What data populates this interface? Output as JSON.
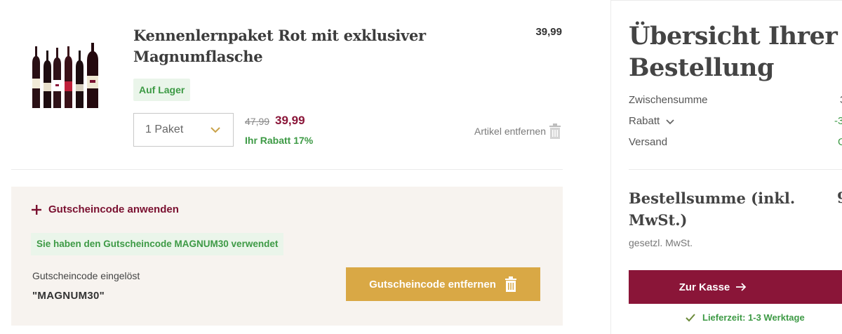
{
  "cart_item": {
    "title": "Kennenlernpaket Rot mit exklusiver Magnumflasche",
    "price": "39,99",
    "stock_status": "Auf Lager",
    "quantity_selected": "1 Paket",
    "old_price": "47,99",
    "new_price": "39,99",
    "discount": "Ihr Rabatt 17%",
    "remove_label": "Artikel entfernen"
  },
  "voucher": {
    "toggle_label": "Gutscheincode anwenden",
    "applied_message": "Sie haben den Gutscheincode MAGNUM30 verwendet",
    "redeemed_label": "Gutscheincode eingelöst",
    "code": "\"MAGNUM30\"",
    "remove_button": "Gutscheincode entfernen"
  },
  "summary": {
    "title": "Übersicht Ihrer Bestellung",
    "rows": [
      {
        "label": "Zwischensumme",
        "value": "3"
      },
      {
        "label": "Rabatt",
        "value": "-3"
      },
      {
        "label": "Versand",
        "value": "G"
      }
    ],
    "total_label": "Bestellsumme (inkl. MwSt.)",
    "total_value": "9",
    "vat_note": "gesetzl. MwSt.",
    "checkout_button": "Zur Kasse",
    "delivery": "Lieferzeit: 1-3 Werktage"
  },
  "colors": {
    "brand_burgundy": "#8a1538",
    "accent_gold": "#d9a845",
    "success_green": "#3d9a45",
    "panel_beige": "#f7f3ef"
  },
  "icons": [
    "wine-bottles-image",
    "chevron-down-icon",
    "trash-icon",
    "plus-icon",
    "arrow-right-icon",
    "check-icon"
  ]
}
